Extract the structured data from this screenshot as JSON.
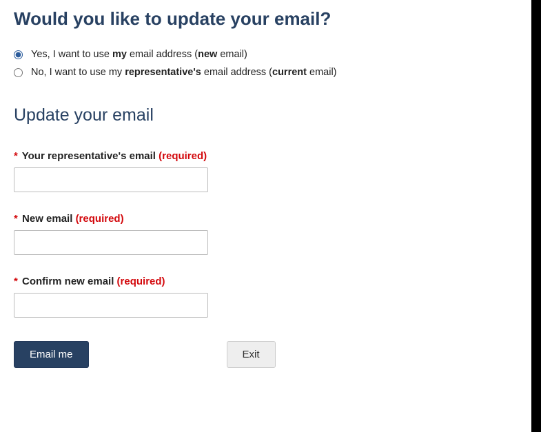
{
  "heading": "Would you like to update your email?",
  "radios": {
    "yes": {
      "pre": "Yes, I want to use ",
      "bold1": "my",
      "mid": " email address (",
      "bold2": "new",
      "post": " email)"
    },
    "no": {
      "pre": "No, I want to use my ",
      "bold1": "representative's",
      "mid": " email address (",
      "bold2": "current",
      "post": " email)"
    }
  },
  "section_title": "Update your email",
  "fields": {
    "rep_email": {
      "label": "Your representative's email",
      "required": "(required)"
    },
    "new_email": {
      "label": "New email",
      "required": "(required)"
    },
    "confirm_email": {
      "label": "Confirm new email",
      "required": "(required)"
    }
  },
  "buttons": {
    "primary": "Email me",
    "secondary": "Exit"
  },
  "asterisk": "*"
}
